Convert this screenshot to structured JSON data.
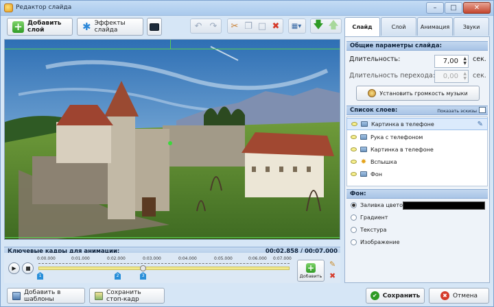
{
  "window": {
    "title": "Редактор слайда"
  },
  "toolbar": {
    "add_layer": "Добавить слой",
    "slide_effects": "Эффекты слайда"
  },
  "timeline": {
    "header": "Ключевые кадры для анимации:",
    "time_display": "00:02.858 / 00:07.000",
    "ruler": [
      "0:00.000",
      "0:01.000",
      "0:02.000",
      "0:03.000",
      "0:04.000",
      "0:05.000",
      "0:06.000",
      "0:07.000"
    ],
    "keyframes": [
      "1",
      "2",
      "3"
    ],
    "add_label": "Добавить",
    "colors": {
      "active_range": "#f1e98c",
      "keyframe": "#2a8fd9"
    }
  },
  "bottom": {
    "add_template": "Добавить в шаблоны",
    "save_still": "Сохранить стоп-кадр",
    "save": "Сохранить",
    "cancel": "Отмена"
  },
  "tabs": [
    "Слайд",
    "Слой",
    "Анимация",
    "Звуки"
  ],
  "slide_params": {
    "header": "Общие параметры слайда:",
    "duration_label": "Длительность:",
    "duration_value": "7,00",
    "duration_unit": "сек.",
    "transition_label": "Длительность перехода:",
    "transition_value": "0,00",
    "transition_unit": "сек.",
    "volume_button": "Установить громкость музыки"
  },
  "layers": {
    "header": "Список слоев:",
    "show_icons": "Показать эскизы",
    "items": [
      "Картинка в телефоне",
      "Рука с телефоном",
      "Картинка в телефоне",
      "Вспышка",
      "Фон"
    ]
  },
  "background": {
    "header": "Фон:",
    "options": [
      "Заливка цветом",
      "Градиент",
      "Текстура",
      "Изображение"
    ],
    "selected": "Заливка цветом",
    "fill_color": "#000000"
  },
  "colors": {
    "accent": "#2c88d9",
    "add_green": "#2f9b25",
    "delete_red": "#d53a2a"
  }
}
